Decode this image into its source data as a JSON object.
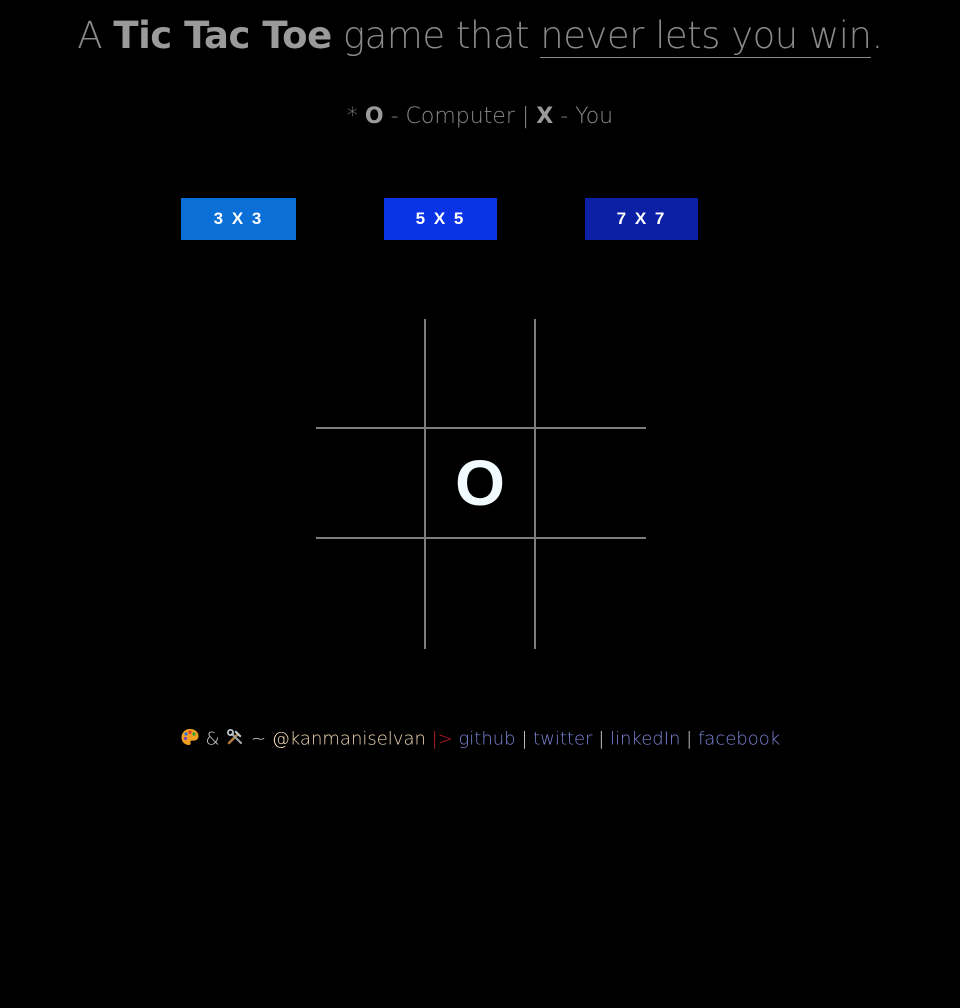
{
  "header": {
    "title_prefix": "A ",
    "title_bold": "Tic Tac Toe",
    "title_middle": " game that ",
    "title_underlined": "never lets you win",
    "title_suffix": "."
  },
  "legend": {
    "prefix": "* ",
    "o_mark": "O",
    "o_text": " - Computer | ",
    "x_mark": "X",
    "x_text": " - You"
  },
  "size_buttons": [
    {
      "label": "3 X 3",
      "color": "#0a6fd6"
    },
    {
      "label": "5 X 5",
      "color": "#0a33e6"
    },
    {
      "label": "7 X 7",
      "color": "#0c20a6"
    }
  ],
  "board": {
    "size": 3,
    "cells": [
      "",
      "",
      "",
      "",
      "O",
      "",
      "",
      "",
      ""
    ]
  },
  "footer": {
    "palette_icon": "palette-icon",
    "amp": " & ",
    "tools_icon": "tools-icon",
    "tilde": " ~ ",
    "handle": "@kanmaniselvan",
    "arrow": " |> ",
    "links": [
      "github",
      "twitter",
      "linkedIn",
      "facebook"
    ],
    "separator": " | "
  }
}
